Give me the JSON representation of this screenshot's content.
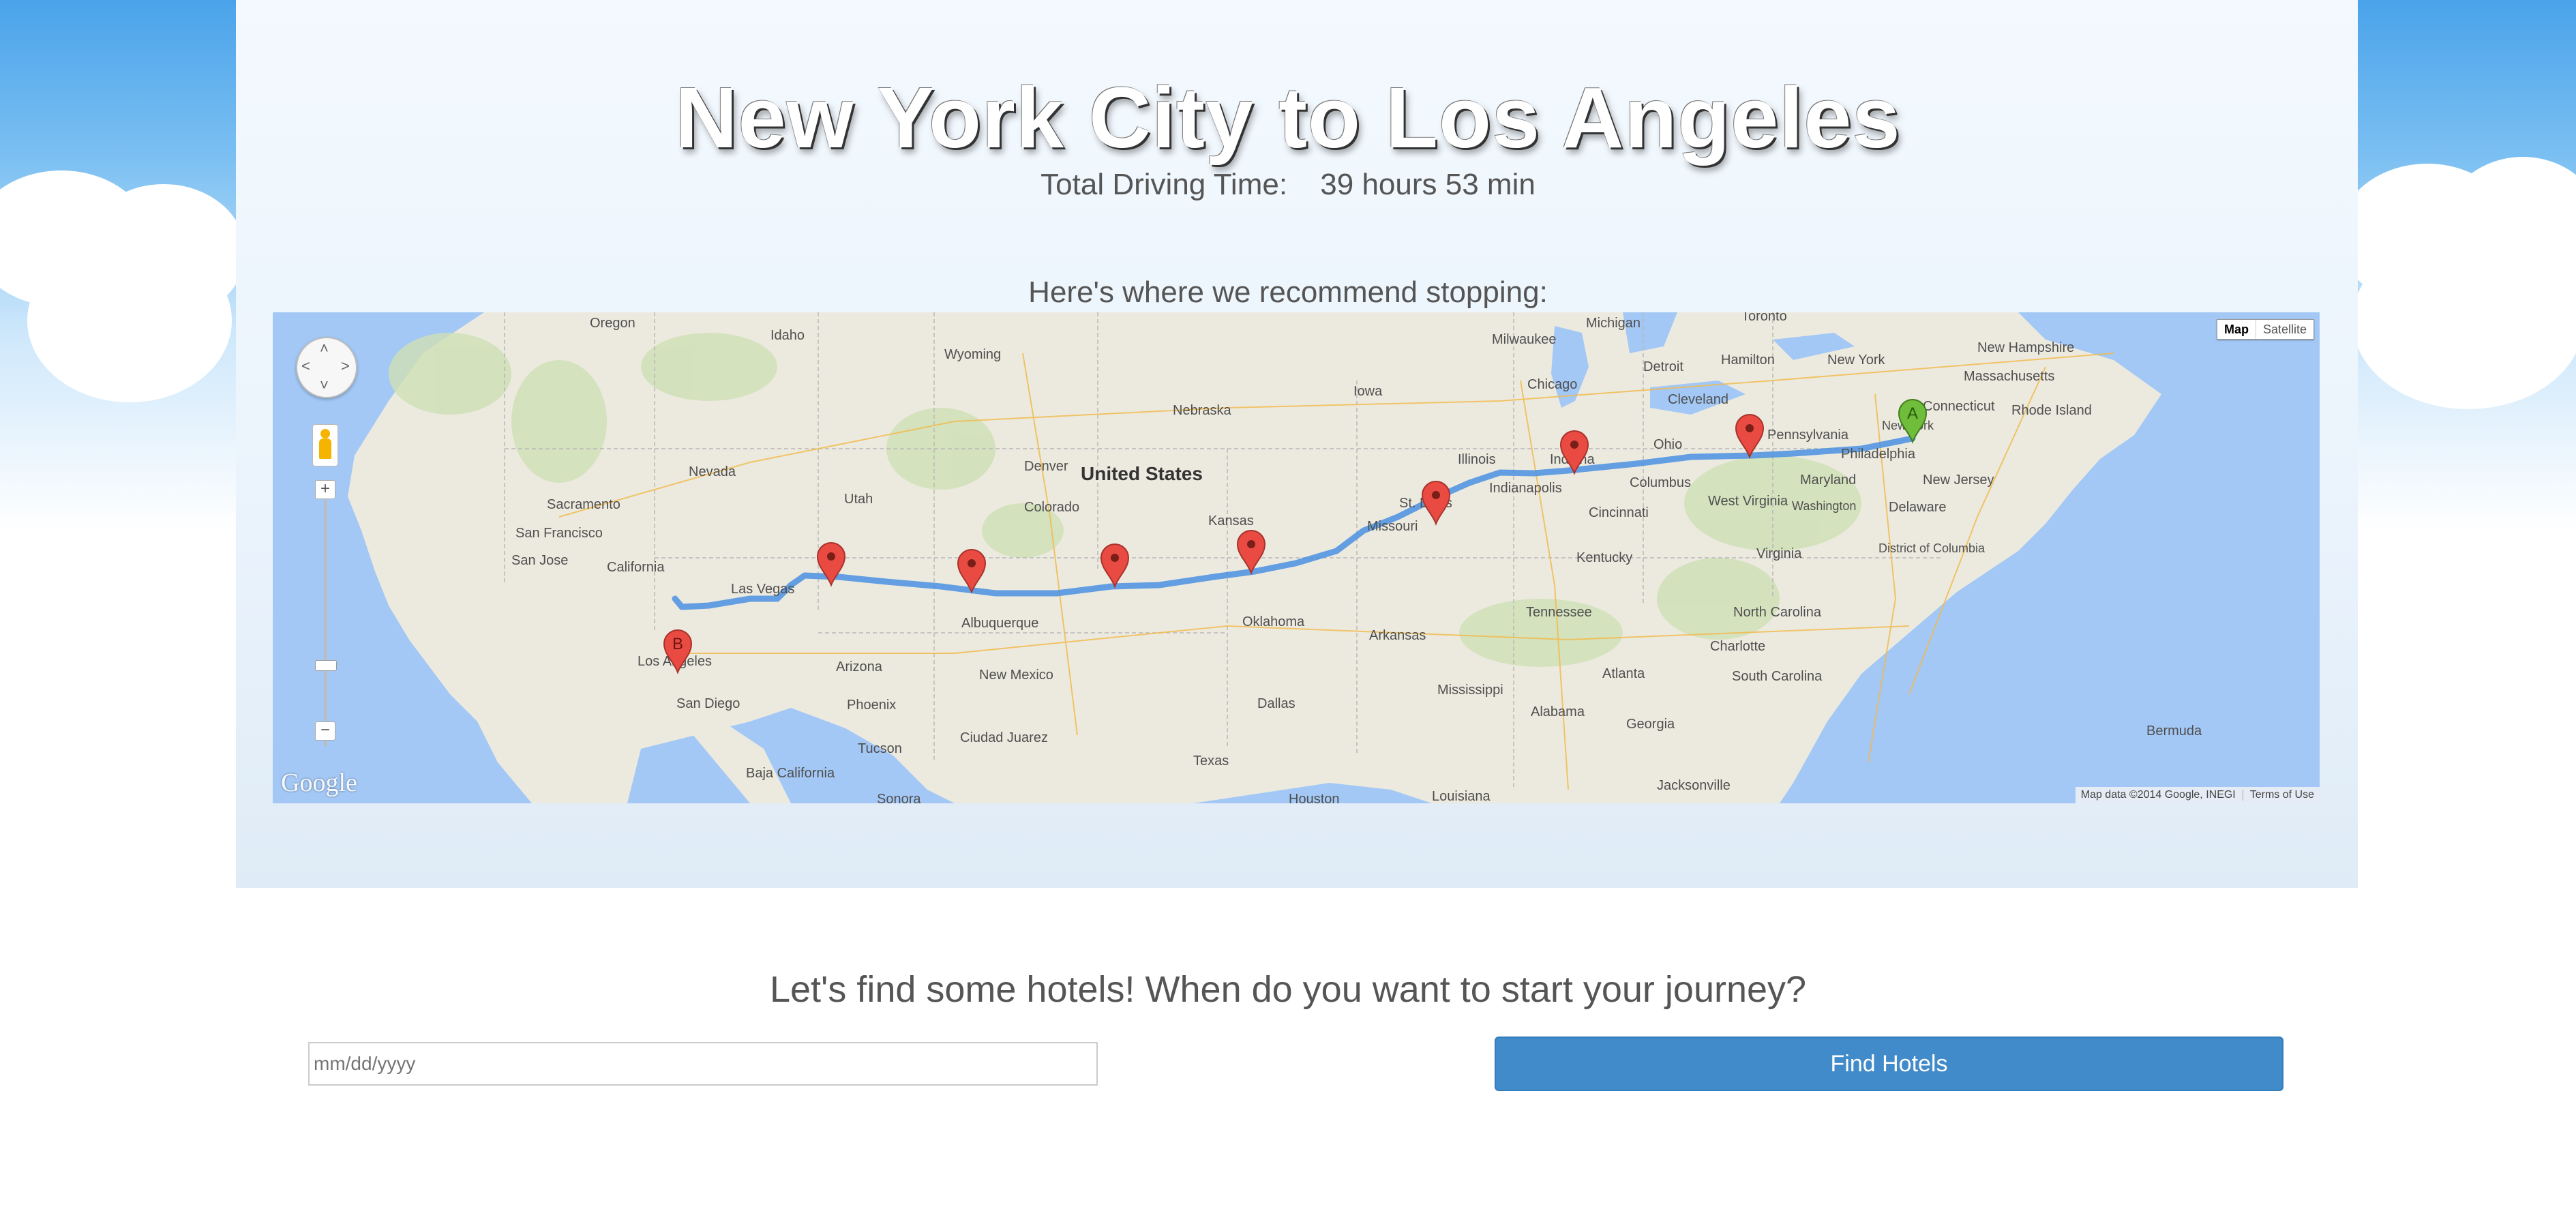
{
  "header": {
    "title": "New York City to Los Angeles",
    "driving_time_label": "Total Driving Time:",
    "driving_time_value": "39 hours 53 min",
    "recommend_text": "Here's where we recommend stopping:"
  },
  "map": {
    "map_type_options": [
      "Map",
      "Satellite"
    ],
    "selected_map_type": "Map",
    "logo_text": "Google",
    "attribution": "Map data ©2014 Google, INEGI",
    "terms_link": "Terms of Use",
    "start_marker_label": "A",
    "end_marker_label": "B",
    "labels": {
      "oregon": "Oregon",
      "idaho": "Idaho",
      "wyoming": "Wyoming",
      "nebraska": "Nebraska",
      "iowa": "Iowa",
      "nevada": "Nevada",
      "utah": "Utah",
      "colorado": "Colorado",
      "united_states": "United States",
      "kansas": "Kansas",
      "missouri": "Missouri",
      "illinois": "Illinois",
      "indiana": "Indiana",
      "ohio": "Ohio",
      "pennsylvania": "Pennsylvania",
      "new_york": "New York",
      "new_york_city": "New York",
      "new_hampshire": "New Hampshire",
      "massachusetts": "Massachusetts",
      "rhode_island": "Rhode Island",
      "connecticut": "Connecticut",
      "new_jersey": "New Jersey",
      "delaware": "Delaware",
      "maryland": "Maryland",
      "washington": "Washington",
      "district_of_columbia": "District of Columbia",
      "west_virginia": "West Virginia",
      "virginia": "Virginia",
      "kentucky": "Kentucky",
      "tennessee": "Tennessee",
      "north_carolina": "North Carolina",
      "south_carolina": "South Carolina",
      "georgia": "Georgia",
      "alabama": "Alabama",
      "mississippi": "Mississippi",
      "arkansas": "Arkansas",
      "oklahoma": "Oklahoma",
      "texas": "Texas",
      "dallas": "Dallas",
      "new_mexico": "New Mexico",
      "albuquerque": "Albuquerque",
      "arizona": "Arizona",
      "phoenix": "Phoenix",
      "tucson": "Tucson",
      "ciudad_juarez": "Ciudad Juarez",
      "california": "California",
      "los_angeles": "Los Angeles",
      "las_vegas": "Las Vegas",
      "san_diego": "San Diego",
      "sacramento": "Sacramento",
      "san_francisco": "San Francisco",
      "san_jose": "San Jose",
      "baja_california": "Baja California",
      "sonora": "Sonora",
      "houston": "Houston",
      "louisiana": "Louisiana",
      "jacksonville": "Jacksonville",
      "atlanta": "Atlanta",
      "charlotte": "Charlotte",
      "philadelphia": "Philadelphia",
      "chicago": "Chicago",
      "milwaukee": "Milwaukee",
      "michigan": "Michigan",
      "detroit": "Detroit",
      "cleveland": "Cleveland",
      "columbus": "Columbus",
      "cincinnati": "Cincinnati",
      "indianapolis": "Indianapolis",
      "st_louis": "St. Louis",
      "denver": "Denver",
      "toronto": "Toronto",
      "hamilton": "Hamilton",
      "bermuda": "Bermuda"
    }
  },
  "hotels": {
    "prompt": "Let's find some hotels! When do you want to start your journey?",
    "date_placeholder": "mm/dd/yyyy",
    "button_label": "Find Hotels"
  },
  "colors": {
    "route": "#4a90e2",
    "marker_stop": "#e94b42",
    "marker_start": "#6fbd3a",
    "button": "#428bca",
    "water": "#a3c8f5",
    "land": "#eceadf"
  }
}
